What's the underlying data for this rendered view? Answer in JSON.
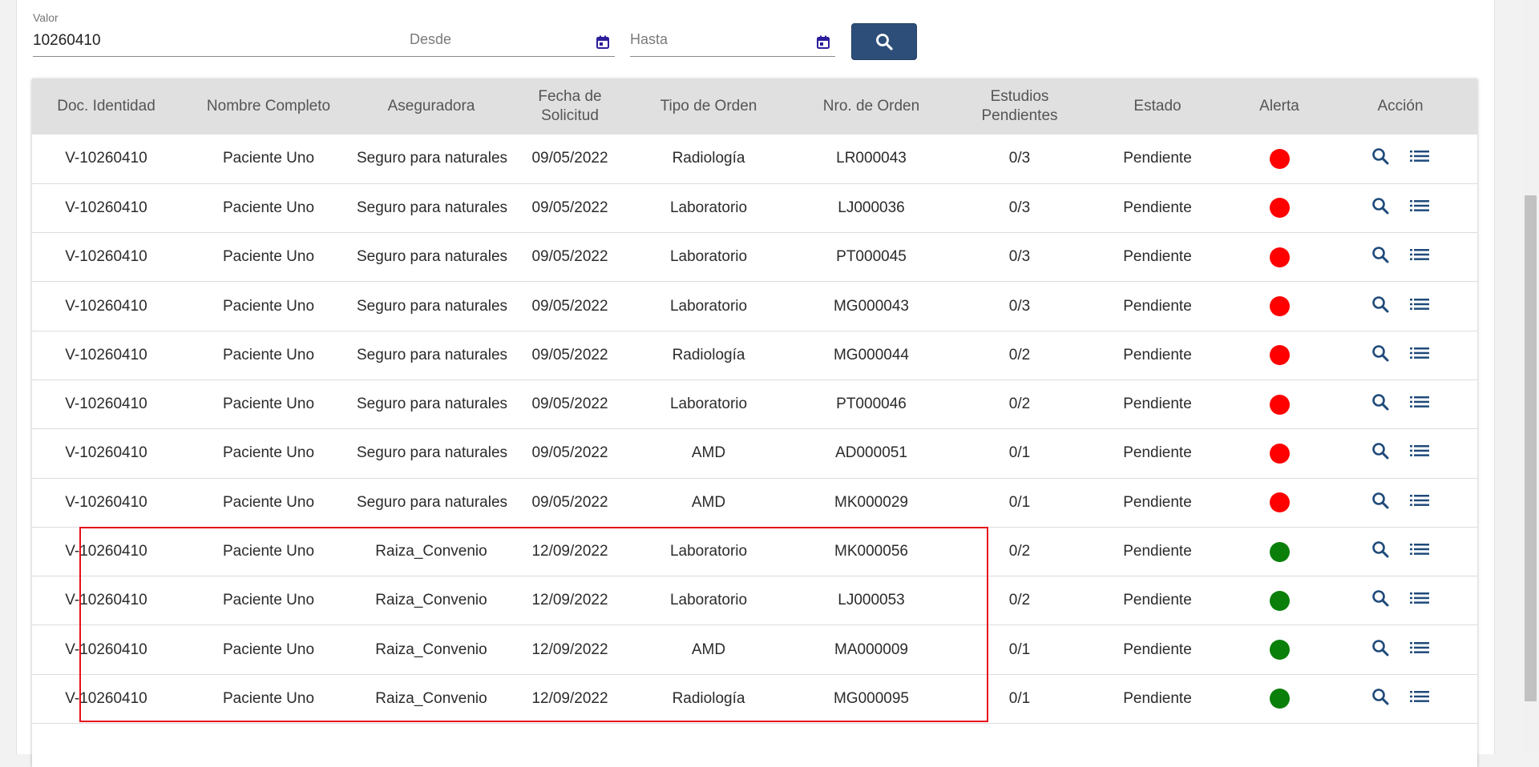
{
  "filters": {
    "valor_label": "Valor",
    "valor_value": "10260410",
    "desde_placeholder": "Desde",
    "hasta_placeholder": "Hasta"
  },
  "table": {
    "headers": {
      "doc": "Doc. Identidad",
      "nombre": "Nombre Completo",
      "aseguradora": "Aseguradora",
      "fecha_line1": "Fecha de",
      "fecha_line2": "Solicitud",
      "tipo": "Tipo de Orden",
      "nro": "Nro. de Orden",
      "estudios_line1": "Estudios",
      "estudios_line2": "Pendientes",
      "estado": "Estado",
      "alerta": "Alerta",
      "accion": "Acción"
    },
    "rows": [
      {
        "doc": "V-10260410",
        "nombre": "Paciente Uno",
        "aseguradora": "Seguro para naturales",
        "fecha": "09/05/2022",
        "tipo": "Radiología",
        "nro": "LR000043",
        "estudios": "0/3",
        "estado": "Pendiente",
        "alert_color": "#ff0000"
      },
      {
        "doc": "V-10260410",
        "nombre": "Paciente Uno",
        "aseguradora": "Seguro para naturales",
        "fecha": "09/05/2022",
        "tipo": "Laboratorio",
        "nro": "LJ000036",
        "estudios": "0/3",
        "estado": "Pendiente",
        "alert_color": "#ff0000"
      },
      {
        "doc": "V-10260410",
        "nombre": "Paciente Uno",
        "aseguradora": "Seguro para naturales",
        "fecha": "09/05/2022",
        "tipo": "Laboratorio",
        "nro": "PT000045",
        "estudios": "0/3",
        "estado": "Pendiente",
        "alert_color": "#ff0000"
      },
      {
        "doc": "V-10260410",
        "nombre": "Paciente Uno",
        "aseguradora": "Seguro para naturales",
        "fecha": "09/05/2022",
        "tipo": "Laboratorio",
        "nro": "MG000043",
        "estudios": "0/3",
        "estado": "Pendiente",
        "alert_color": "#ff0000"
      },
      {
        "doc": "V-10260410",
        "nombre": "Paciente Uno",
        "aseguradora": "Seguro para naturales",
        "fecha": "09/05/2022",
        "tipo": "Radiología",
        "nro": "MG000044",
        "estudios": "0/2",
        "estado": "Pendiente",
        "alert_color": "#ff0000"
      },
      {
        "doc": "V-10260410",
        "nombre": "Paciente Uno",
        "aseguradora": "Seguro para naturales",
        "fecha": "09/05/2022",
        "tipo": "Laboratorio",
        "nro": "PT000046",
        "estudios": "0/2",
        "estado": "Pendiente",
        "alert_color": "#ff0000"
      },
      {
        "doc": "V-10260410",
        "nombre": "Paciente Uno",
        "aseguradora": "Seguro para naturales",
        "fecha": "09/05/2022",
        "tipo": "AMD",
        "nro": "AD000051",
        "estudios": "0/1",
        "estado": "Pendiente",
        "alert_color": "#ff0000"
      },
      {
        "doc": "V-10260410",
        "nombre": "Paciente Uno",
        "aseguradora": "Seguro para naturales",
        "fecha": "09/05/2022",
        "tipo": "AMD",
        "nro": "MK000029",
        "estudios": "0/1",
        "estado": "Pendiente",
        "alert_color": "#ff0000"
      },
      {
        "doc": "V-10260410",
        "nombre": "Paciente Uno",
        "aseguradora": "Raiza_Convenio",
        "fecha": "12/09/2022",
        "tipo": "Laboratorio",
        "nro": "MK000056",
        "estudios": "0/2",
        "estado": "Pendiente",
        "alert_color": "#0a7f0a"
      },
      {
        "doc": "V-10260410",
        "nombre": "Paciente Uno",
        "aseguradora": "Raiza_Convenio",
        "fecha": "12/09/2022",
        "tipo": "Laboratorio",
        "nro": "LJ000053",
        "estudios": "0/2",
        "estado": "Pendiente",
        "alert_color": "#0a7f0a"
      },
      {
        "doc": "V-10260410",
        "nombre": "Paciente Uno",
        "aseguradora": "Raiza_Convenio",
        "fecha": "12/09/2022",
        "tipo": "AMD",
        "nro": "MA000009",
        "estudios": "0/1",
        "estado": "Pendiente",
        "alert_color": "#0a7f0a"
      },
      {
        "doc": "V-10260410",
        "nombre": "Paciente Uno",
        "aseguradora": "Raiza_Convenio",
        "fecha": "12/09/2022",
        "tipo": "Radiología",
        "nro": "MG000095",
        "estudios": "0/1",
        "estado": "Pendiente",
        "alert_color": "#0a7f0a"
      }
    ]
  },
  "icons": {
    "search": "search-icon",
    "calendar": "calendar-icon",
    "list": "list-icon"
  },
  "colors": {
    "primary": "#2d4e78",
    "alert_red": "#ff0000",
    "alert_green": "#0a7f0a",
    "action_icon": "#1f4a7a",
    "highlight": "#e5101a"
  }
}
